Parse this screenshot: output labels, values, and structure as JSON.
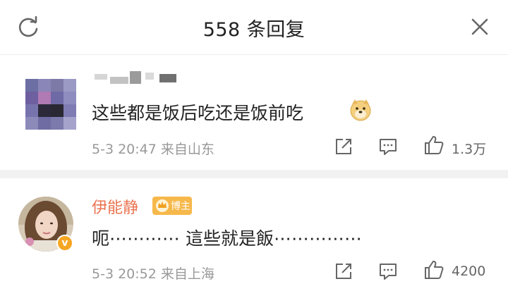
{
  "header": {
    "title": "558 条回复",
    "refresh_icon": "refresh-icon",
    "close_icon": "close-icon"
  },
  "comments": [
    {
      "author_visible": false,
      "text": "这些都是饭后吃还是饭前吃",
      "emoji": "doge-emoji-icon",
      "time": "5-3 20:47",
      "location": "来自山东",
      "likes": "1.3万"
    },
    {
      "author": "伊能静",
      "badge": "博主",
      "verified_badge": "v",
      "text": "呃⋯⋯⋯⋯ 這些就是飯⋯⋯⋯⋯⋯",
      "time": "5-3 20:52",
      "location": "来自上海",
      "likes": "4200"
    }
  ],
  "colors": {
    "author_name": "#eb7350",
    "badge_bg": "#f7b84b",
    "meta_text": "#999999",
    "divider_bg": "#f2f2f2"
  }
}
